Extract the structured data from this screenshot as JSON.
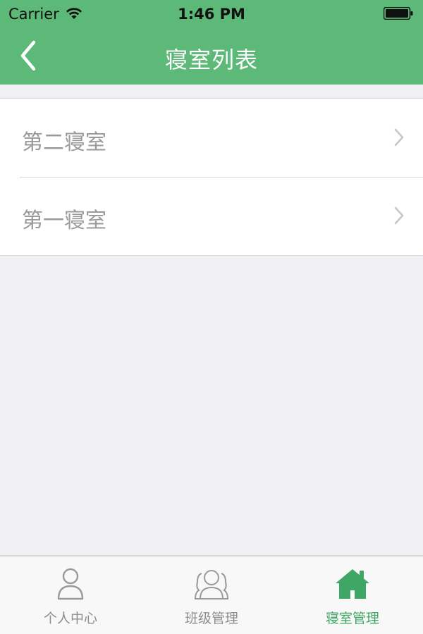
{
  "status_bar": {
    "carrier": "Carrier",
    "time": "1:46 PM"
  },
  "nav": {
    "title": "寝室列表",
    "back_icon": "chevron-left-icon"
  },
  "dorms": [
    {
      "label": "第二寝室",
      "icon": "chevron-right-icon"
    },
    {
      "label": "第一寝室",
      "icon": "chevron-right-icon"
    }
  ],
  "tabs": [
    {
      "label": "个人中心",
      "icon": "person-icon",
      "active": false
    },
    {
      "label": "班级管理",
      "icon": "group-icon",
      "active": false
    },
    {
      "label": "寝室管理",
      "icon": "house-icon",
      "active": true
    }
  ],
  "colors": {
    "brand_green": "#5cb977",
    "active_tab": "#3fa766",
    "inactive_tab": "#8e8e8e",
    "background": "#efeff4"
  }
}
